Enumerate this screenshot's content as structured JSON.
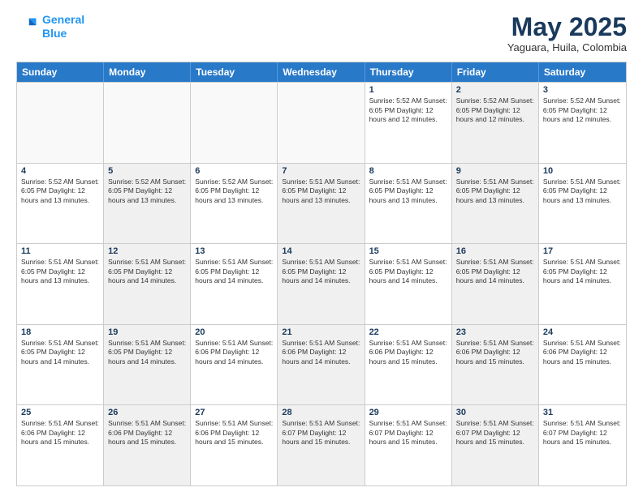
{
  "header": {
    "logo_line1": "General",
    "logo_line2": "Blue",
    "month_title": "May 2025",
    "subtitle": "Yaguara, Huila, Colombia"
  },
  "weekdays": [
    "Sunday",
    "Monday",
    "Tuesday",
    "Wednesday",
    "Thursday",
    "Friday",
    "Saturday"
  ],
  "rows": [
    [
      {
        "day": "",
        "text": "",
        "empty": true
      },
      {
        "day": "",
        "text": "",
        "empty": true
      },
      {
        "day": "",
        "text": "",
        "empty": true
      },
      {
        "day": "",
        "text": "",
        "empty": true
      },
      {
        "day": "1",
        "text": "Sunrise: 5:52 AM\nSunset: 6:05 PM\nDaylight: 12 hours\nand 12 minutes.",
        "shaded": false
      },
      {
        "day": "2",
        "text": "Sunrise: 5:52 AM\nSunset: 6:05 PM\nDaylight: 12 hours\nand 12 minutes.",
        "shaded": true
      },
      {
        "day": "3",
        "text": "Sunrise: 5:52 AM\nSunset: 6:05 PM\nDaylight: 12 hours\nand 12 minutes.",
        "shaded": false
      }
    ],
    [
      {
        "day": "4",
        "text": "Sunrise: 5:52 AM\nSunset: 6:05 PM\nDaylight: 12 hours\nand 13 minutes.",
        "shaded": false
      },
      {
        "day": "5",
        "text": "Sunrise: 5:52 AM\nSunset: 6:05 PM\nDaylight: 12 hours\nand 13 minutes.",
        "shaded": true
      },
      {
        "day": "6",
        "text": "Sunrise: 5:52 AM\nSunset: 6:05 PM\nDaylight: 12 hours\nand 13 minutes.",
        "shaded": false
      },
      {
        "day": "7",
        "text": "Sunrise: 5:51 AM\nSunset: 6:05 PM\nDaylight: 12 hours\nand 13 minutes.",
        "shaded": true
      },
      {
        "day": "8",
        "text": "Sunrise: 5:51 AM\nSunset: 6:05 PM\nDaylight: 12 hours\nand 13 minutes.",
        "shaded": false
      },
      {
        "day": "9",
        "text": "Sunrise: 5:51 AM\nSunset: 6:05 PM\nDaylight: 12 hours\nand 13 minutes.",
        "shaded": true
      },
      {
        "day": "10",
        "text": "Sunrise: 5:51 AM\nSunset: 6:05 PM\nDaylight: 12 hours\nand 13 minutes.",
        "shaded": false
      }
    ],
    [
      {
        "day": "11",
        "text": "Sunrise: 5:51 AM\nSunset: 6:05 PM\nDaylight: 12 hours\nand 13 minutes.",
        "shaded": false
      },
      {
        "day": "12",
        "text": "Sunrise: 5:51 AM\nSunset: 6:05 PM\nDaylight: 12 hours\nand 14 minutes.",
        "shaded": true
      },
      {
        "day": "13",
        "text": "Sunrise: 5:51 AM\nSunset: 6:05 PM\nDaylight: 12 hours\nand 14 minutes.",
        "shaded": false
      },
      {
        "day": "14",
        "text": "Sunrise: 5:51 AM\nSunset: 6:05 PM\nDaylight: 12 hours\nand 14 minutes.",
        "shaded": true
      },
      {
        "day": "15",
        "text": "Sunrise: 5:51 AM\nSunset: 6:05 PM\nDaylight: 12 hours\nand 14 minutes.",
        "shaded": false
      },
      {
        "day": "16",
        "text": "Sunrise: 5:51 AM\nSunset: 6:05 PM\nDaylight: 12 hours\nand 14 minutes.",
        "shaded": true
      },
      {
        "day": "17",
        "text": "Sunrise: 5:51 AM\nSunset: 6:05 PM\nDaylight: 12 hours\nand 14 minutes.",
        "shaded": false
      }
    ],
    [
      {
        "day": "18",
        "text": "Sunrise: 5:51 AM\nSunset: 6:05 PM\nDaylight: 12 hours\nand 14 minutes.",
        "shaded": false
      },
      {
        "day": "19",
        "text": "Sunrise: 5:51 AM\nSunset: 6:05 PM\nDaylight: 12 hours\nand 14 minutes.",
        "shaded": true
      },
      {
        "day": "20",
        "text": "Sunrise: 5:51 AM\nSunset: 6:06 PM\nDaylight: 12 hours\nand 14 minutes.",
        "shaded": false
      },
      {
        "day": "21",
        "text": "Sunrise: 5:51 AM\nSunset: 6:06 PM\nDaylight: 12 hours\nand 14 minutes.",
        "shaded": true
      },
      {
        "day": "22",
        "text": "Sunrise: 5:51 AM\nSunset: 6:06 PM\nDaylight: 12 hours\nand 15 minutes.",
        "shaded": false
      },
      {
        "day": "23",
        "text": "Sunrise: 5:51 AM\nSunset: 6:06 PM\nDaylight: 12 hours\nand 15 minutes.",
        "shaded": true
      },
      {
        "day": "24",
        "text": "Sunrise: 5:51 AM\nSunset: 6:06 PM\nDaylight: 12 hours\nand 15 minutes.",
        "shaded": false
      }
    ],
    [
      {
        "day": "25",
        "text": "Sunrise: 5:51 AM\nSunset: 6:06 PM\nDaylight: 12 hours\nand 15 minutes.",
        "shaded": false
      },
      {
        "day": "26",
        "text": "Sunrise: 5:51 AM\nSunset: 6:06 PM\nDaylight: 12 hours\nand 15 minutes.",
        "shaded": true
      },
      {
        "day": "27",
        "text": "Sunrise: 5:51 AM\nSunset: 6:06 PM\nDaylight: 12 hours\nand 15 minutes.",
        "shaded": false
      },
      {
        "day": "28",
        "text": "Sunrise: 5:51 AM\nSunset: 6:07 PM\nDaylight: 12 hours\nand 15 minutes.",
        "shaded": true
      },
      {
        "day": "29",
        "text": "Sunrise: 5:51 AM\nSunset: 6:07 PM\nDaylight: 12 hours\nand 15 minutes.",
        "shaded": false
      },
      {
        "day": "30",
        "text": "Sunrise: 5:51 AM\nSunset: 6:07 PM\nDaylight: 12 hours\nand 15 minutes.",
        "shaded": true
      },
      {
        "day": "31",
        "text": "Sunrise: 5:51 AM\nSunset: 6:07 PM\nDaylight: 12 hours\nand 15 minutes.",
        "shaded": false
      }
    ]
  ]
}
